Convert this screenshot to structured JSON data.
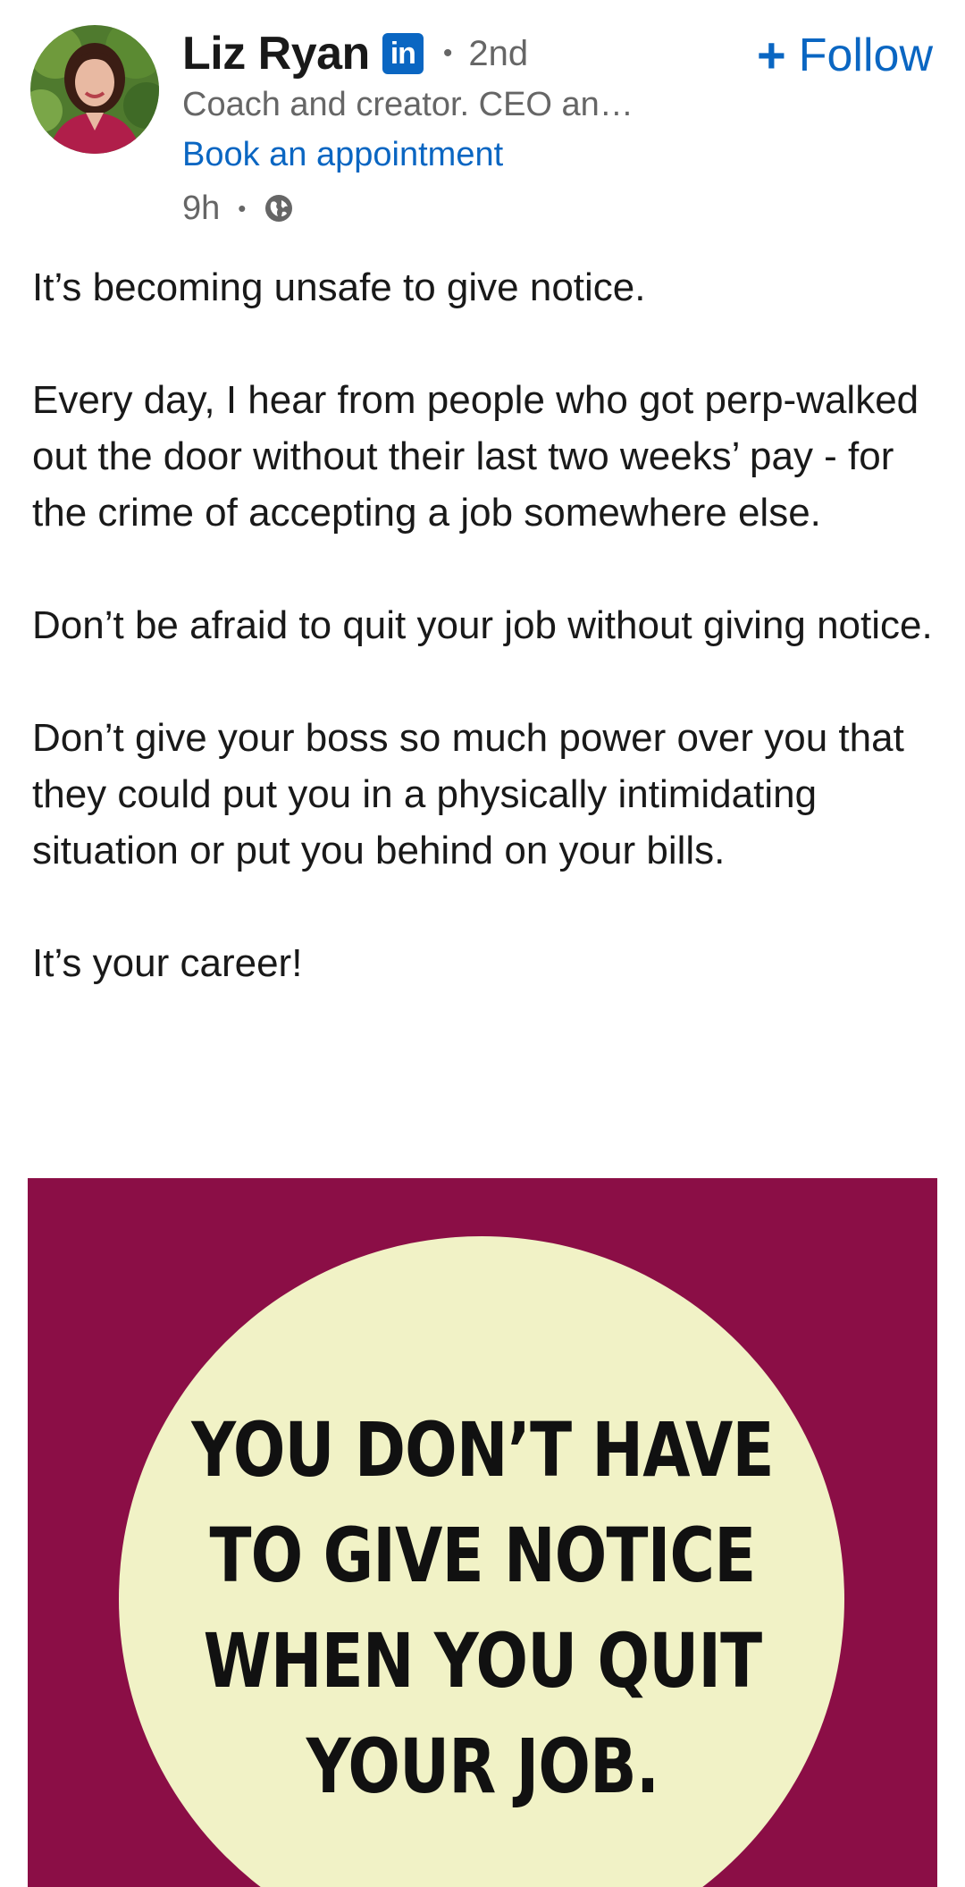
{
  "author": {
    "name": "Liz Ryan",
    "network_badge_icon": "linkedin-icon",
    "badge_text": "in",
    "degree": "2nd",
    "separator": "•",
    "headline": "Coach and creator. CEO an…",
    "link_text": "Book an appointment"
  },
  "follow": {
    "plus": "+",
    "label": "Follow"
  },
  "meta": {
    "time": "9h",
    "separator": "•",
    "visibility_icon": "globe-icon"
  },
  "post": {
    "paragraphs": [
      "It’s becoming unsafe to give notice.",
      "Every day, I hear from people who got perp-walked out the door without their last two weeks’ pay - for the crime of accepting a job somewhere else.",
      "Don’t be afraid to quit your job without giving notice.",
      "Don’t give your boss so much power over you that they could put you in a physically intimidating situation or put you behind on your bills.",
      "It’s your career!"
    ]
  },
  "image": {
    "lines": [
      "YOU DON’T HAVE",
      "TO GIVE NOTICE",
      "WHEN YOU QUIT",
      "YOUR JOB."
    ],
    "background_color": "#8b0e46",
    "circle_color": "#f1f2c6"
  },
  "colors": {
    "accent": "#0a66c2",
    "text": "#191919",
    "muted": "#666666"
  }
}
